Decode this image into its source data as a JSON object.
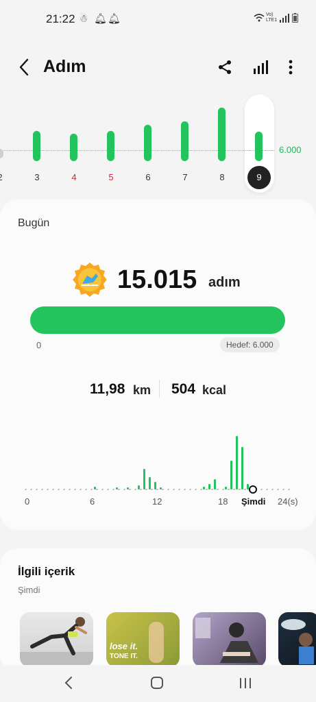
{
  "status": {
    "time": "21:22",
    "network": "Vo) LTE1"
  },
  "header": {
    "title": "Adım"
  },
  "week": {
    "days": [
      "2",
      "3",
      "4",
      "5",
      "6",
      "7",
      "8",
      "9"
    ],
    "goal_label": "6.000",
    "selected_day": "9"
  },
  "today": {
    "label": "Bugün",
    "steps": "15.015",
    "steps_unit": "adım",
    "progress_start": "0",
    "goal": "Hedef: 6.000",
    "distance": "11,98",
    "distance_unit": "km",
    "calories": "504",
    "calories_unit": "kcal"
  },
  "hourly": {
    "labels": [
      "0",
      "6",
      "12",
      "18",
      "Şimdi",
      "24(s)"
    ]
  },
  "related": {
    "title": "İlgili içerik",
    "subtitle": "Şimdi",
    "thumb2_text": "lose it.",
    "thumb2_text2": "TONE IT."
  },
  "colors": {
    "accent": "#23c45e",
    "background": "#f4f4f4"
  }
}
